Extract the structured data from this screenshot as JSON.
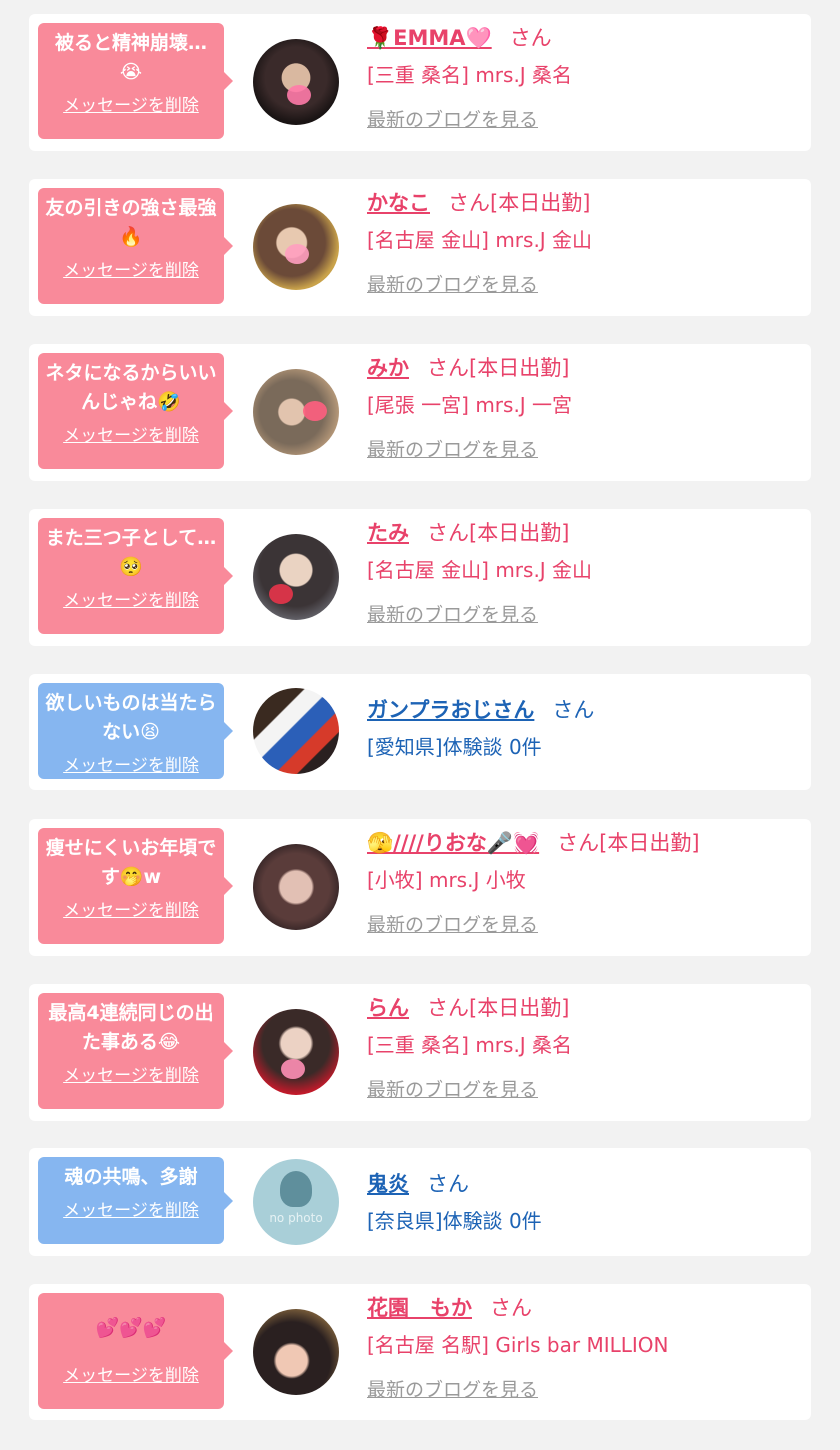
{
  "colors": {
    "pink_bubble": "#f98a9a",
    "blue_bubble": "#86b6f0",
    "pink_text": "#e8426a",
    "blue_text": "#1d63b5",
    "link_gray": "#9a9a9a"
  },
  "cards": [
    {
      "type": "pink",
      "message": "被ると精神崩壊…😭",
      "delete_label": "メッセージを削除",
      "name": "🌹EMMA🩷",
      "suffix": "さん",
      "store": "[三重 桑名] mrs.J 桑名",
      "blog": "最新のブログを見る",
      "avatar": "avatar-photo-emma"
    },
    {
      "type": "pink",
      "message": "友の引きの強さ最強🔥",
      "delete_label": "メッセージを削除",
      "name": "かなこ",
      "suffix": "さん[本日出勤]",
      "store": "[名古屋 金山] mrs.J 金山",
      "blog": "最新のブログを見る",
      "avatar": "avatar-photo-kanako"
    },
    {
      "type": "pink",
      "message": "ネタになるからいいんじゃね🤣",
      "delete_label": "メッセージを削除",
      "name": "みか",
      "suffix": "さん[本日出勤]",
      "store": "[尾張 一宮] mrs.J 一宮",
      "blog": "最新のブログを見る",
      "avatar": "avatar-photo-mika"
    },
    {
      "type": "pink",
      "message": "また三つ子として…🥺",
      "delete_label": "メッセージを削除",
      "name": "たみ",
      "suffix": "さん[本日出勤]",
      "store": "[名古屋 金山] mrs.J 金山",
      "blog": "最新のブログを見る",
      "avatar": "avatar-photo-tami"
    },
    {
      "type": "blue",
      "message": "欲しいものは当たらない😫",
      "delete_label": "メッセージを削除",
      "name": "ガンプラおじさん",
      "suffix": "さん",
      "store": "[愛知県]体験談 0件",
      "blog": "",
      "avatar": "avatar-photo-gundam"
    },
    {
      "type": "pink",
      "message": "痩せにくいお年頃です🤭w",
      "delete_label": "メッセージを削除",
      "name": "🫣////りおな🎤💓",
      "suffix": "さん[本日出勤]",
      "store": "[小牧] mrs.J 小牧",
      "blog": "最新のブログを見る",
      "avatar": "avatar-photo-riona"
    },
    {
      "type": "pink",
      "message": "最高4連続同じの出た事ある😂",
      "delete_label": "メッセージを削除",
      "name": "らん",
      "suffix": "さん[本日出勤]",
      "store": "[三重 桑名] mrs.J 桑名",
      "blog": "最新のブログを見る",
      "avatar": "avatar-photo-ran"
    },
    {
      "type": "blue",
      "message": "魂の共鳴、多謝",
      "delete_label": "メッセージを削除",
      "name": "鬼炎",
      "suffix": "さん",
      "store": "[奈良県]体験談 0件",
      "blog": "",
      "avatar": "avatar-no-photo",
      "avatar_text": "no photo"
    },
    {
      "type": "pink",
      "message": "💕💕💕",
      "delete_label": "メッセージを削除",
      "name": "花園　もか",
      "suffix": "さん",
      "store": "[名古屋 名駅] Girls bar MILLION",
      "blog": "最新のブログを見る",
      "avatar": "avatar-photo-moka"
    }
  ]
}
